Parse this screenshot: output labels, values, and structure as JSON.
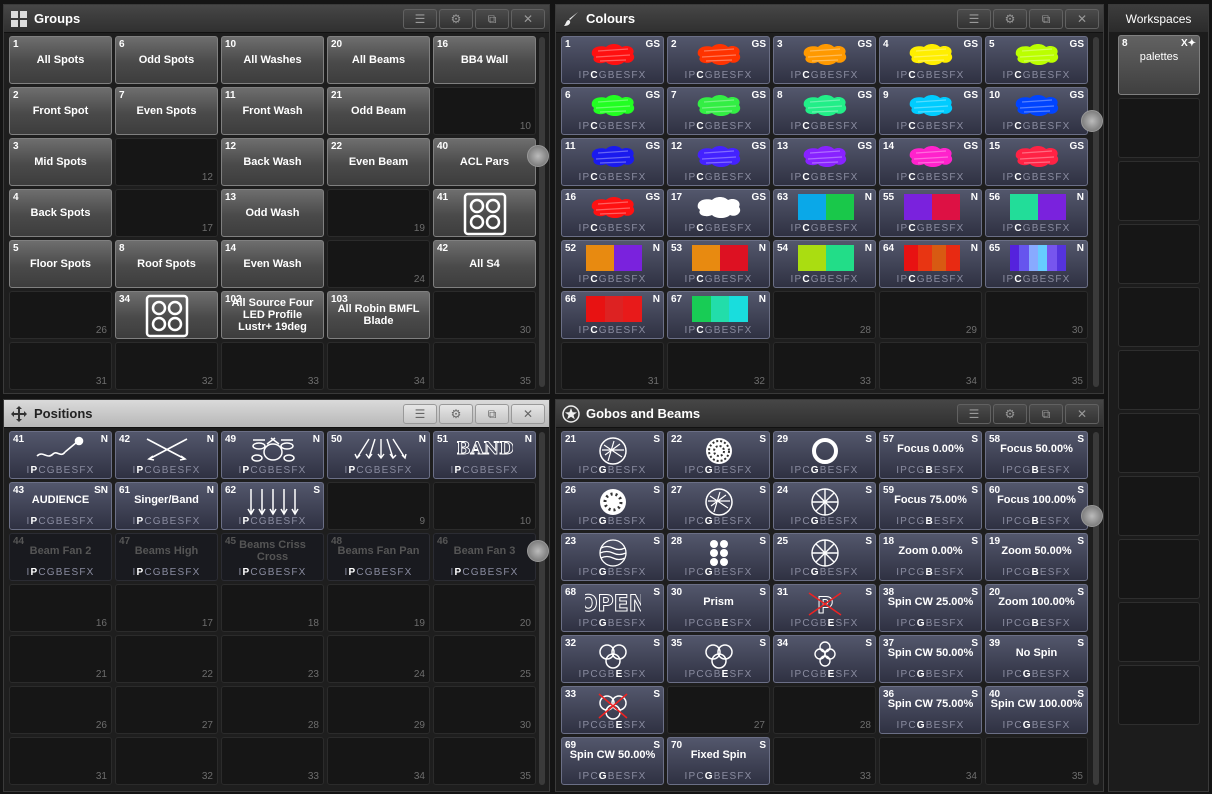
{
  "windows": {
    "groups": {
      "title": "Groups",
      "icon": "grid-icon"
    },
    "colours": {
      "title": "Colours",
      "icon": "paintbrush-icon"
    },
    "positions": {
      "title": "Positions",
      "icon": "move-arrows-icon"
    },
    "gobos": {
      "title": "Gobos and Beams",
      "icon": "star-icon"
    }
  },
  "groups": [
    {
      "n": "1",
      "l": "All Spots"
    },
    {
      "n": "6",
      "l": "Odd Spots"
    },
    {
      "n": "10",
      "l": "All Washes"
    },
    {
      "n": "20",
      "l": "All Beams"
    },
    {
      "n": "16",
      "l": "BB4 Wall"
    },
    {
      "n": "2",
      "l": "Front Spot"
    },
    {
      "n": "7",
      "l": "Even Spots"
    },
    {
      "n": "11",
      "l": "Front Wash"
    },
    {
      "n": "21",
      "l": "Odd Beam"
    },
    {
      "e": "10"
    },
    {
      "n": "3",
      "l": "Mid Spots"
    },
    {
      "e": "12"
    },
    {
      "n": "12",
      "l": "Back Wash"
    },
    {
      "n": "22",
      "l": "Even Beam"
    },
    {
      "n": "40",
      "l": "ACL Pars"
    },
    {
      "n": "4",
      "l": "Back Spots"
    },
    {
      "e": "17"
    },
    {
      "n": "13",
      "l": "Odd Wash"
    },
    {
      "e": "19"
    },
    {
      "n": "41",
      "img": "quad"
    },
    {
      "n": "5",
      "l": "Floor Spots"
    },
    {
      "n": "8",
      "l": "Roof Spots"
    },
    {
      "n": "14",
      "l": "Even Wash"
    },
    {
      "e": "24"
    },
    {
      "n": "42",
      "l": "All S4"
    },
    {
      "e": "26"
    },
    {
      "n": "34",
      "img": "quad"
    },
    {
      "n": "102",
      "l": "All Source Four LED Profile Lustr+ 19deg"
    },
    {
      "n": "103",
      "l": "All Robin BMFL Blade"
    },
    {
      "e": "30"
    },
    {
      "e": "31"
    },
    {
      "e": "32"
    },
    {
      "e": "33"
    },
    {
      "e": "34"
    },
    {
      "e": "35"
    }
  ],
  "colours": [
    {
      "n": "1",
      "b": "GS",
      "c": "#ff1010"
    },
    {
      "n": "2",
      "b": "GS",
      "c": "#ff3300"
    },
    {
      "n": "3",
      "b": "GS",
      "c": "#ff9900"
    },
    {
      "n": "4",
      "b": "GS",
      "c": "#ffee00"
    },
    {
      "n": "5",
      "b": "GS",
      "c": "#bbff00"
    },
    {
      "n": "6",
      "b": "GS",
      "c": "#22ff22"
    },
    {
      "n": "7",
      "b": "GS",
      "c": "#33ee44"
    },
    {
      "n": "8",
      "b": "GS",
      "c": "#22ee88"
    },
    {
      "n": "9",
      "b": "GS",
      "c": "#00ccff"
    },
    {
      "n": "10",
      "b": "GS",
      "c": "#0044ff"
    },
    {
      "n": "11",
      "b": "GS",
      "c": "#1a1aee"
    },
    {
      "n": "12",
      "b": "GS",
      "c": "#4422ff"
    },
    {
      "n": "13",
      "b": "GS",
      "c": "#8822ff"
    },
    {
      "n": "14",
      "b": "GS",
      "c": "#ff22cc"
    },
    {
      "n": "15",
      "b": "GS",
      "c": "#ff2244"
    },
    {
      "n": "16",
      "b": "GS",
      "c": "#ff1111"
    },
    {
      "n": "17",
      "b": "GS",
      "c": "#ffffff"
    },
    {
      "n": "63",
      "b": "N",
      "sw": [
        "#0aa8e8",
        "#19c84a"
      ]
    },
    {
      "n": "55",
      "b": "N",
      "sw": [
        "#7a22dd",
        "#dd1144"
      ]
    },
    {
      "n": "56",
      "b": "N",
      "sw": [
        "#22dd99",
        "#7a22dd"
      ]
    },
    {
      "n": "52",
      "b": "N",
      "sw": [
        "#e88a10",
        "#7a22dd"
      ]
    },
    {
      "n": "53",
      "b": "N",
      "sw": [
        "#e88a10",
        "#dd1122"
      ]
    },
    {
      "n": "54",
      "b": "N",
      "sw": [
        "#aadd11",
        "#22dd88"
      ]
    },
    {
      "n": "64",
      "b": "N",
      "sw": [
        "#e81212",
        "#e83512",
        "#d85a12",
        "#e82a12"
      ]
    },
    {
      "n": "65",
      "b": "N",
      "sw": [
        "#5522dd",
        "#6655ee",
        "#88aaff",
        "#66ccff",
        "#7755ee",
        "#5533dd"
      ]
    },
    {
      "n": "66",
      "b": "N",
      "sw": [
        "#e81212",
        "#dd2222",
        "#e81a1a"
      ]
    },
    {
      "n": "67",
      "b": "N",
      "sw": [
        "#18cc55",
        "#22ddaa",
        "#19dddd"
      ]
    },
    {
      "e": "28"
    },
    {
      "e": "29"
    },
    {
      "e": "30"
    },
    {
      "e": "31"
    },
    {
      "e": "32"
    },
    {
      "e": "33"
    },
    {
      "e": "34"
    },
    {
      "e": "35"
    }
  ],
  "positions": [
    {
      "n": "41",
      "b": "N",
      "img": "mic",
      "m": "P"
    },
    {
      "n": "42",
      "b": "N",
      "img": "cross",
      "m": "P"
    },
    {
      "n": "49",
      "b": "N",
      "img": "drums",
      "m": "P"
    },
    {
      "n": "50",
      "b": "N",
      "img": "fan",
      "m": "P"
    },
    {
      "n": "51",
      "b": "N",
      "img": "band",
      "m": "P"
    },
    {
      "n": "43",
      "b": "SN",
      "l": "AUDIENCE",
      "m": "P"
    },
    {
      "n": "61",
      "b": "N",
      "l": "Singer/Band",
      "m": "P"
    },
    {
      "n": "62",
      "b": "S",
      "img": "down",
      "m": "P"
    },
    {
      "e": "9"
    },
    {
      "e": "10"
    },
    {
      "n": "44",
      "l": "Beam Fan 2",
      "d": true,
      "m": "P"
    },
    {
      "n": "47",
      "l": "Beams High",
      "d": true,
      "m": "P"
    },
    {
      "n": "45",
      "l": "Beams Criss Cross",
      "d": true,
      "m": "P"
    },
    {
      "n": "48",
      "l": "Beams Fan Pan",
      "d": true,
      "m": "P"
    },
    {
      "n": "46",
      "l": "Beam Fan 3",
      "d": true,
      "m": "P"
    },
    {
      "e": "16"
    },
    {
      "e": "17"
    },
    {
      "e": "18"
    },
    {
      "e": "19"
    },
    {
      "e": "20"
    },
    {
      "e": "21"
    },
    {
      "e": "22"
    },
    {
      "e": "23"
    },
    {
      "e": "24"
    },
    {
      "e": "25"
    },
    {
      "e": "26"
    },
    {
      "e": "27"
    },
    {
      "e": "28"
    },
    {
      "e": "29"
    },
    {
      "e": "30"
    },
    {
      "e": "31"
    },
    {
      "e": "32"
    },
    {
      "e": "33"
    },
    {
      "e": "34"
    },
    {
      "e": "35"
    }
  ],
  "gobos": [
    {
      "n": "21",
      "b": "S",
      "img": "gobo1",
      "m": "G"
    },
    {
      "n": "22",
      "b": "S",
      "img": "gobo2",
      "m": "G"
    },
    {
      "n": "29",
      "b": "S",
      "img": "ring",
      "m": "G"
    },
    {
      "n": "57",
      "b": "S",
      "l": "Focus 0.00%",
      "m": "B"
    },
    {
      "n": "58",
      "b": "S",
      "l": "Focus 50.00%",
      "m": "B"
    },
    {
      "n": "26",
      "b": "S",
      "img": "gobo3",
      "m": "G"
    },
    {
      "n": "27",
      "b": "S",
      "img": "gobo1",
      "m": "G"
    },
    {
      "n": "24",
      "b": "S",
      "img": "spokes",
      "m": "G"
    },
    {
      "n": "59",
      "b": "S",
      "l": "Focus 75.00%",
      "m": "B"
    },
    {
      "n": "60",
      "b": "S",
      "l": "Focus 100.00%",
      "m": "B"
    },
    {
      "n": "23",
      "b": "S",
      "img": "waves",
      "m": "G"
    },
    {
      "n": "28",
      "b": "S",
      "img": "dots",
      "m": "G"
    },
    {
      "n": "25",
      "b": "S",
      "img": "spokes",
      "m": "G"
    },
    {
      "n": "18",
      "b": "S",
      "l": "Zoom 0.00%",
      "m": "B"
    },
    {
      "n": "19",
      "b": "S",
      "l": "Zoom 50.00%",
      "m": "B"
    },
    {
      "n": "68",
      "b": "S",
      "img": "open",
      "m": "G"
    },
    {
      "n": "30",
      "b": "S",
      "l": "Prism",
      "m": "E"
    },
    {
      "n": "31",
      "b": "S",
      "img": "noprism",
      "m": "E"
    },
    {
      "n": "38",
      "b": "S",
      "l": "Spin CW 25.00%",
      "m": "G"
    },
    {
      "n": "20",
      "b": "S",
      "l": "Zoom 100.00%",
      "m": "B"
    },
    {
      "n": "32",
      "b": "S",
      "img": "prism3",
      "m": "E"
    },
    {
      "n": "35",
      "b": "S",
      "img": "prism3",
      "m": "E"
    },
    {
      "n": "34",
      "b": "S",
      "img": "prism4",
      "m": "E"
    },
    {
      "n": "37",
      "b": "S",
      "l": "Spin CW 50.00%",
      "m": "G"
    },
    {
      "n": "39",
      "b": "S",
      "l": "No Spin",
      "m": "G"
    },
    {
      "n": "33",
      "b": "S",
      "img": "noprism3",
      "m": "E"
    },
    {
      "e": "27"
    },
    {
      "e": "28"
    },
    {
      "n": "36",
      "b": "S",
      "l": "Spin CW 75.00%",
      "m": "G"
    },
    {
      "n": "40",
      "b": "S",
      "l": "Spin CW 100.00%",
      "m": "G"
    },
    {
      "n": "69",
      "b": "S",
      "l": "Spin CW 50.00%",
      "m": "G"
    },
    {
      "n": "70",
      "b": "S",
      "l": "Fixed Spin",
      "m": "G"
    },
    {
      "e": "33"
    },
    {
      "e": "34"
    },
    {
      "e": "35"
    }
  ],
  "mask_letters": [
    "I",
    "P",
    "C",
    "G",
    "B",
    "E",
    "S",
    "FX"
  ],
  "workspaces": {
    "title": "Workspaces",
    "active": {
      "n": "8",
      "l": "palettes",
      "badge": "X✦"
    },
    "slots": 11
  }
}
